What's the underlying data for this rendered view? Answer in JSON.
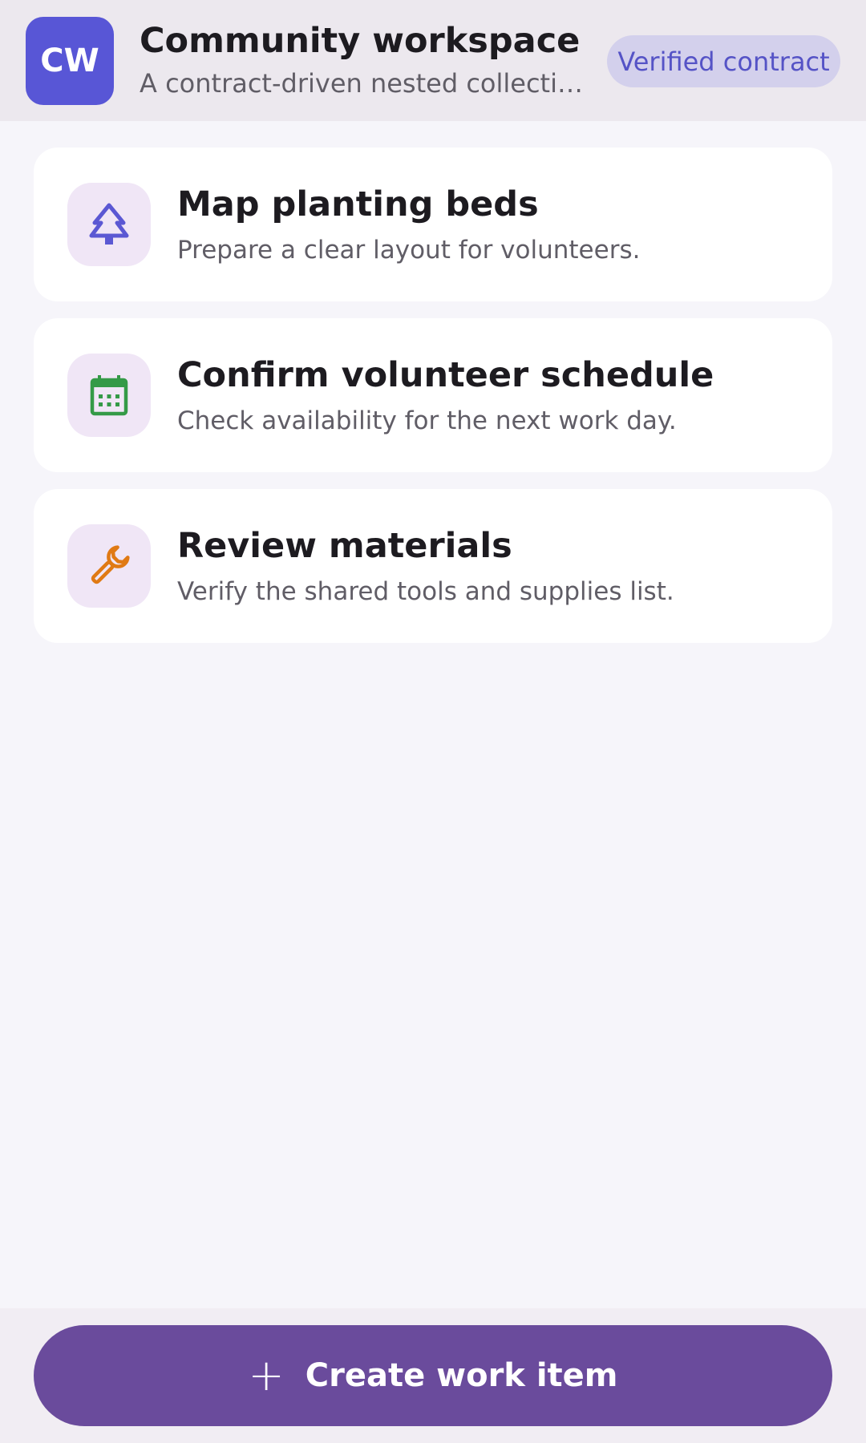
{
  "header": {
    "avatar_initials": "CW",
    "title": "Community workspace",
    "subtitle": "A contract-driven nested collection …",
    "badge": "Verified contract"
  },
  "items": [
    {
      "title": "Map planting beds",
      "subtitle": "Prepare a clear layout for volunteers.",
      "icon": "tree-icon",
      "icon_color": "#5b58d3"
    },
    {
      "title": "Confirm volunteer schedule",
      "subtitle": "Check availability for the next work day.",
      "icon": "calendar-icon",
      "icon_color": "#349a47"
    },
    {
      "title": "Review materials",
      "subtitle": "Verify the shared tools and supplies list.",
      "icon": "wrench-icon",
      "icon_color": "#e07a14"
    }
  ],
  "create_button": {
    "label": "Create work item",
    "icon": "plus-icon"
  },
  "colors": {
    "accent": "#5856d6",
    "primary_button": "#6a4b9c",
    "badge_bg": "#d3d0ec"
  }
}
